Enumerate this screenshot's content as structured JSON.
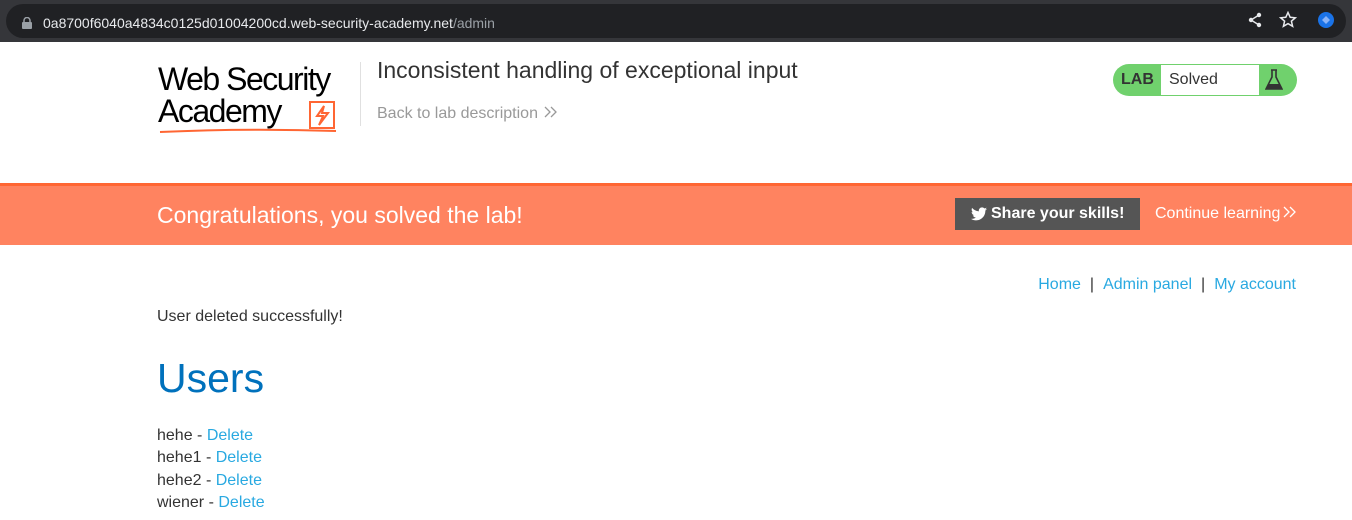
{
  "browser": {
    "url_host": "0a8700f6040a4834c0125d01004200cd.web-security-academy.net",
    "url_path": "/admin"
  },
  "header": {
    "logo_line1": "Web Security",
    "logo_line2": "Academy",
    "lab_title": "Inconsistent handling of exceptional input",
    "back_link": "Back to lab description",
    "lab_badge": "LAB",
    "lab_status": "Solved"
  },
  "banner": {
    "message": "Congratulations, you solved the lab!",
    "share_button": "Share your skills!",
    "continue_link": "Continue learning"
  },
  "nav": {
    "home": "Home",
    "admin": "Admin panel",
    "account": "My account",
    "separator": "|"
  },
  "main": {
    "message": "User deleted successfully!",
    "heading": "Users",
    "delete_label": "Delete",
    "users": [
      {
        "name": "hehe",
        "dash": " - "
      },
      {
        "name": "hehe1",
        "dash": " - "
      },
      {
        "name": "hehe2",
        "dash": " - "
      },
      {
        "name": "wiener",
        "dash": " - "
      }
    ]
  },
  "colors": {
    "banner": "#ff8360",
    "link": "#29a9e1",
    "heading": "#0071bc",
    "status_green": "#70d16d"
  }
}
